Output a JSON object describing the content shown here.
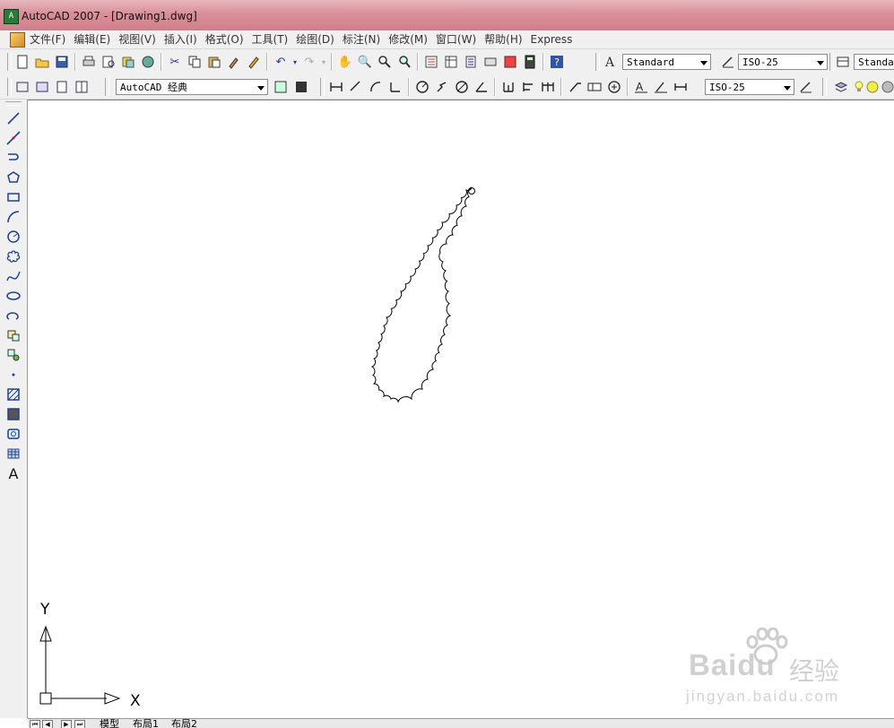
{
  "window": {
    "title": "AutoCAD 2007 - [Drawing1.dwg]",
    "app_icon_glyph": "A"
  },
  "menu": [
    "文件(F)",
    "编辑(E)",
    "视图(V)",
    "插入(I)",
    "格式(O)",
    "工具(T)",
    "绘图(D)",
    "标注(N)",
    "修改(M)",
    "窗口(W)",
    "帮助(H)",
    "Express"
  ],
  "toolbar_standard": {
    "text_style": "Standard",
    "dim_style": "ISO-25",
    "table_style": "Standard"
  },
  "toolbar_workspace": {
    "workspace": "AutoCAD 经典",
    "dim_style": "ISO-25"
  },
  "icons": {
    "standard_row": [
      "new-icon",
      "open-icon",
      "save-icon",
      "plot-icon",
      "plot-preview-icon",
      "publish-icon",
      "3d-dwf-icon",
      "cut-icon",
      "copy-icon",
      "paste-icon",
      "match-properties-icon",
      "block-editor-icon",
      "undo-icon",
      "redo-icon",
      "pan-icon",
      "zoom-realtime-icon",
      "zoom-window-icon",
      "zoom-previous-icon",
      "properties-icon",
      "design-center-icon",
      "tool-palettes-icon",
      "sheet-set-icon",
      "markup-icon",
      "quickcalc-icon",
      "help-icon"
    ],
    "draw_column": [
      "line-icon",
      "construction-line-icon",
      "polyline-icon",
      "polygon-icon",
      "rectangle-icon",
      "arc-icon",
      "circle-icon",
      "revision-cloud-icon",
      "spline-icon",
      "ellipse-icon",
      "ellipse-arc-icon",
      "insert-block-icon",
      "make-block-icon",
      "point-icon",
      "hatch-icon",
      "gradient-icon",
      "region-icon",
      "table-icon",
      "multiline-text-icon"
    ]
  },
  "drawing": {
    "shape": "revision-cloud",
    "stroke_color": "#000000"
  },
  "ucs": {
    "x_label": "X",
    "y_label": "Y"
  },
  "layout_tabs": [
    "模型",
    "布局1",
    "布局2"
  ],
  "watermark": {
    "brand": "Baidu",
    "brand_cn": "经验",
    "url": "jingyan.baidu.com"
  },
  "colors": {
    "titlebar": "#d98f99",
    "toolbar_bg": "#f0f0f0",
    "canvas_bg": "#ffffff"
  }
}
